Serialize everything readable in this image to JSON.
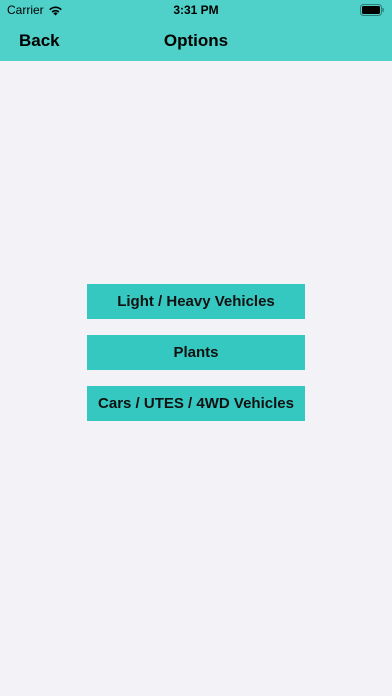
{
  "status_bar": {
    "carrier": "Carrier",
    "time": "3:31 PM",
    "wifi_icon": "wifi-icon",
    "battery_icon": "battery-icon"
  },
  "nav": {
    "back_label": "Back",
    "title": "Options"
  },
  "options": [
    {
      "label": "Light / Heavy Vehicles"
    },
    {
      "label": "Plants"
    },
    {
      "label": "Cars / UTES / 4WD Vehicles"
    }
  ],
  "colors": {
    "header": "#4FD0C9",
    "button": "#35C8C1",
    "background": "#F2F2F7"
  }
}
